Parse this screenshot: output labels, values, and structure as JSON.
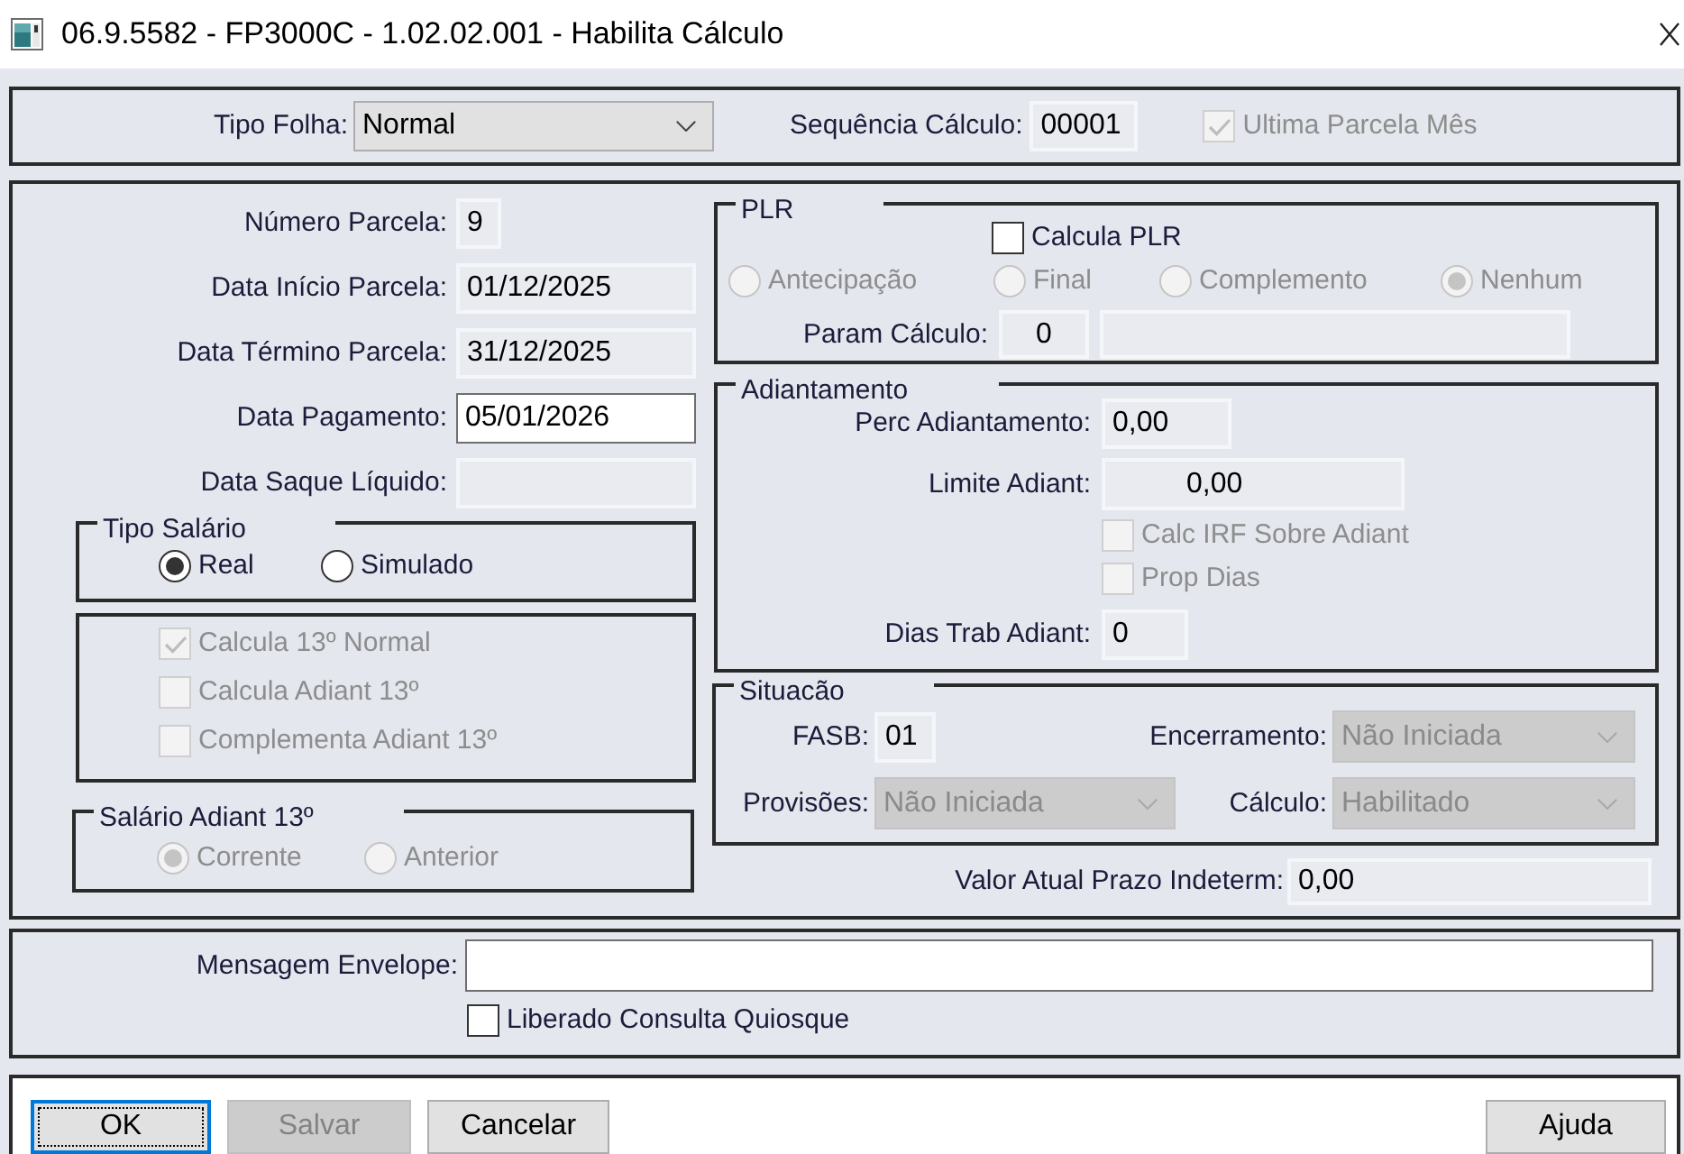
{
  "window": {
    "title": "06.9.5582 - FP3000C - 1.02.02.001 - Habilita Cálculo"
  },
  "header": {
    "tipo_folha": {
      "label": "Tipo Folha:",
      "value": "Normal",
      "disabled": false
    },
    "sequencia": {
      "label": "Sequência Cálculo:",
      "value": "00001",
      "editable": false
    },
    "ultima_parcela": {
      "label": "Ultima Parcela Mês",
      "checked": true,
      "disabled": true
    }
  },
  "parcela": [
    {
      "kind": "number",
      "label": "Número Parcela:",
      "value": "9",
      "editable": false
    },
    {
      "kind": "date",
      "label": "Data Início Parcela:",
      "value": "01/12/2025",
      "editable": false
    },
    {
      "kind": "date",
      "label": "Data Término Parcela:",
      "value": "31/12/2025",
      "editable": false
    },
    {
      "kind": "date",
      "label": "Data Pagamento:",
      "value": "05/01/2026",
      "editable": true
    },
    {
      "kind": "date",
      "label": "Data Saque Líquido:",
      "editable": false
    }
  ],
  "tipo_salario": {
    "title": "Tipo Salário",
    "disabled": false,
    "options": [
      {
        "label": "Real",
        "selected": true
      },
      {
        "label": "Simulado",
        "selected": false
      }
    ]
  },
  "calculo_13": [
    {
      "label": "Calcula 13º Normal",
      "checked": true,
      "disabled": true
    },
    {
      "label": "Calcula Adiant 13º",
      "checked": false,
      "disabled": true
    },
    {
      "label": "Complementa Adiant 13º",
      "checked": false,
      "disabled": true
    }
  ],
  "salario_adiant_13": {
    "title": "Salário Adiant 13º",
    "disabled": true,
    "options": [
      {
        "label": "Corrente",
        "selected": true
      },
      {
        "label": "Anterior",
        "selected": false
      }
    ]
  },
  "plr": {
    "title": "PLR",
    "calcula": {
      "label": "Calcula PLR",
      "checked": false,
      "disabled": false
    },
    "disabled": true,
    "options": [
      {
        "label": "Antecipação",
        "selected": false
      },
      {
        "label": "Final",
        "selected": false
      },
      {
        "label": "Complemento",
        "selected": false
      },
      {
        "label": "Nenhum",
        "selected": true
      }
    ],
    "param": {
      "label": "Param Cálculo:",
      "value": "0",
      "editable": false
    }
  },
  "adiantamento": {
    "title": "Adiantamento",
    "perc": {
      "label": "Perc Adiantamento:",
      "value": "0,00",
      "editable": false
    },
    "limite": {
      "label": "Limite Adiant:",
      "value": "0,00",
      "editable": false
    },
    "checkboxes": [
      {
        "label": "Calc IRF Sobre Adiant",
        "checked": false,
        "disabled": true
      },
      {
        "label": "Prop Dias",
        "checked": false,
        "disabled": true
      }
    ],
    "dias": {
      "label": "Dias Trab Adiant:",
      "value": "0",
      "editable": false
    }
  },
  "situacao": {
    "title": "Situacão",
    "fasb": {
      "label": "FASB:",
      "value": "01",
      "editable": false
    },
    "encerramento": {
      "label": "Encerramento:",
      "value": "Não Iniciada",
      "disabled": true
    },
    "provisoes": {
      "label": "Provisões:",
      "value": "Não Iniciada",
      "disabled": true
    },
    "calculo": {
      "label": "Cálculo:",
      "value": "Habilitado",
      "disabled": true
    }
  },
  "valor_prazo": {
    "label": "Valor Atual Prazo Indeterm:",
    "value": "0,00",
    "editable": false
  },
  "envelope": {
    "mensagem": {
      "label": "Mensagem Envelope:",
      "editable": true
    },
    "quiosque": {
      "label": "Liberado Consulta Quiosque",
      "checked": false,
      "disabled": false
    }
  },
  "buttons": [
    {
      "label": "OK",
      "disabled": false,
      "focused": true
    },
    {
      "label": "Salvar",
      "disabled": true,
      "focused": false
    },
    {
      "label": "Cancelar",
      "disabled": false,
      "focused": false
    }
  ],
  "help_button": {
    "label": "Ajuda",
    "disabled": false
  }
}
